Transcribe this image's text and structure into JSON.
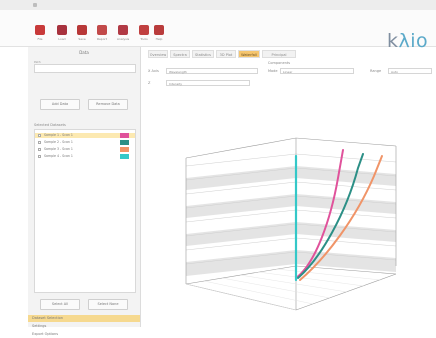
{
  "window": {
    "title": ""
  },
  "toolbar": {
    "buttons": [
      {
        "label": "File",
        "icon": "file-icon",
        "color": "#c83a3a"
      },
      {
        "label": "Load",
        "icon": "load-icon",
        "color": "#a8323e"
      },
      {
        "label": "Save",
        "icon": "save-icon",
        "color": "#b83838"
      },
      {
        "label": "Report",
        "icon": "report-icon",
        "color": "#c24a4a"
      },
      {
        "label": "Analysis",
        "icon": "analysis-icon",
        "color": "#b13a45"
      },
      {
        "label": "Tools",
        "icon": "tools-icon",
        "color": "#c04040"
      },
      {
        "label": "Help",
        "icon": "help-icon",
        "color": "#b93c3c"
      }
    ],
    "logo_k": "k",
    "logo_rest": "λio"
  },
  "left": {
    "title": "Data",
    "field_label": "Path",
    "btn_a": "Add Data",
    "btn_b": "Remove Data",
    "list_header": "Selected Datasets",
    "items": [
      {
        "label": "Sample 1 - Scan 1",
        "color": "#e0529b",
        "selected": true
      },
      {
        "label": "Sample 2 - Scan 1",
        "color": "#2b8f86",
        "selected": false
      },
      {
        "label": "Sample 3 - Scan 1",
        "color": "#f09468",
        "selected": false
      },
      {
        "label": "Sample 4 - Scan 1",
        "color": "#34c8c8",
        "selected": false
      }
    ],
    "btn_c": "Select All",
    "btn_d": "Select None",
    "bottom": [
      {
        "label": "Dataset Selection",
        "active": true
      },
      {
        "label": "Settings",
        "active": false
      },
      {
        "label": "Export Options",
        "active": false
      }
    ]
  },
  "tabs": [
    "Overview",
    "Spectra",
    "Statistics",
    "3D Plot",
    "Waterfall",
    "Principal Components"
  ],
  "active_tab": 4,
  "options": {
    "x_label": "X Axis",
    "x_value": "Wavelength",
    "mode_label": "Mode",
    "mode_value": "Linear",
    "range_label": "Range",
    "range_value": "Auto",
    "z_label": "Z",
    "z_value": "Intensity"
  },
  "chart_data": {
    "type": "line",
    "title": "",
    "series": [
      {
        "color": "#e0529b",
        "values": [
          0,
          1,
          2,
          3,
          4
        ]
      },
      {
        "color": "#2b8f86",
        "values": [
          0,
          1,
          2,
          3,
          4
        ]
      },
      {
        "color": "#f09468",
        "values": [
          0,
          1,
          2,
          3,
          4
        ]
      },
      {
        "color": "#34c8c8",
        "values": [
          0,
          1,
          2,
          3,
          4
        ]
      }
    ],
    "grid": true,
    "legend": "none"
  }
}
